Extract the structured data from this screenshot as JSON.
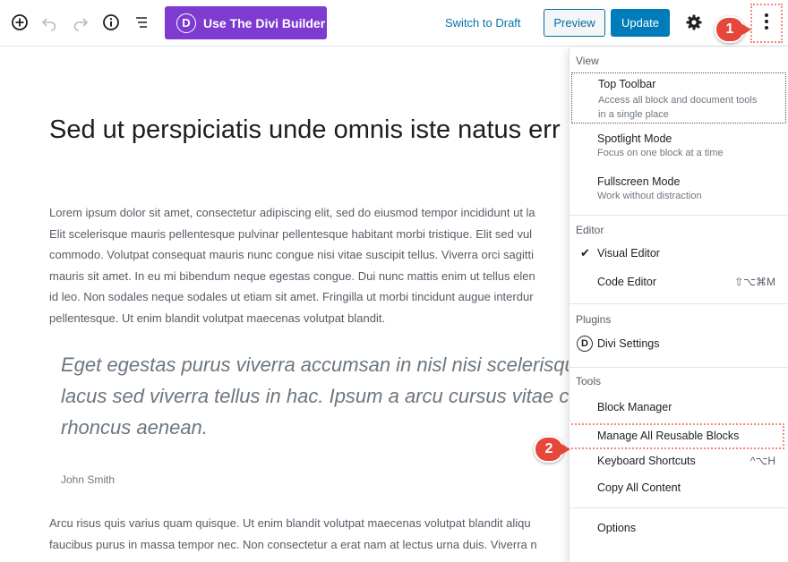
{
  "toolbar": {
    "divi_button": "Use The Divi Builder",
    "divi_logo": "D",
    "switch_to_draft": "Switch to Draft",
    "preview": "Preview",
    "update": "Update"
  },
  "badges": {
    "first": "1",
    "second": "2"
  },
  "post": {
    "title": "Sed ut perspiciatis unde omnis iste natus err",
    "paragraph1": [
      "Lorem ipsum dolor sit amet, consectetur adipiscing elit, sed do eiusmod tempor incididunt ut la",
      "Elit scelerisque mauris pellentesque pulvinar pellentesque habitant morbi tristique. Elit sed vul",
      "commodo. Volutpat consequat mauris nunc congue nisi vitae suscipit tellus. Viverra orci sagitti",
      "mauris sit amet. In eu mi bibendum neque egestas congue. Dui nunc mattis enim ut tellus elen",
      "id leo. Non sodales neque sodales ut etiam sit amet. Fringilla ut morbi tincidunt augue interdur",
      "pellentesque. Ut enim blandit volutpat maecenas volutpat blandit."
    ],
    "quote": [
      "Eget egestas purus viverra accumsan in nisl nisi scelerisqu",
      "lacus sed viverra tellus in hac. Ipsum a arcu cursus vitae c",
      "rhoncus aenean."
    ],
    "citation": "John Smith",
    "paragraph2": [
      "Arcu risus quis varius quam quisque. Ut enim blandit volutpat maecenas volutpat blandit aliqu",
      "faucibus purus in massa tempor nec. Non consectetur a erat nam at lectus urna duis. Viverra n"
    ]
  },
  "menu": {
    "view": {
      "heading": "View",
      "top_toolbar": {
        "label": "Top Toolbar",
        "desc1": "Access all block and document tools",
        "desc2": "in a single place"
      },
      "spotlight": {
        "label": "Spotlight Mode",
        "desc": "Focus on one block at a time"
      },
      "fullscreen": {
        "label": "Fullscreen Mode",
        "desc": "Work without distraction"
      }
    },
    "editor": {
      "heading": "Editor",
      "visual": "Visual Editor",
      "check": "✔",
      "code": "Code Editor",
      "code_shortcut": "⇧⌥⌘M"
    },
    "plugins": {
      "heading": "Plugins",
      "divi_settings": "Divi Settings",
      "divi_logo": "D"
    },
    "tools": {
      "heading": "Tools",
      "block_manager": "Block Manager",
      "manage_reusable": "Manage All Reusable Blocks",
      "keyboard_shortcuts": "Keyboard Shortcuts",
      "keyboard_shortcut_keys": "^⌥H",
      "copy_all": "Copy All Content"
    },
    "options": "Options"
  }
}
